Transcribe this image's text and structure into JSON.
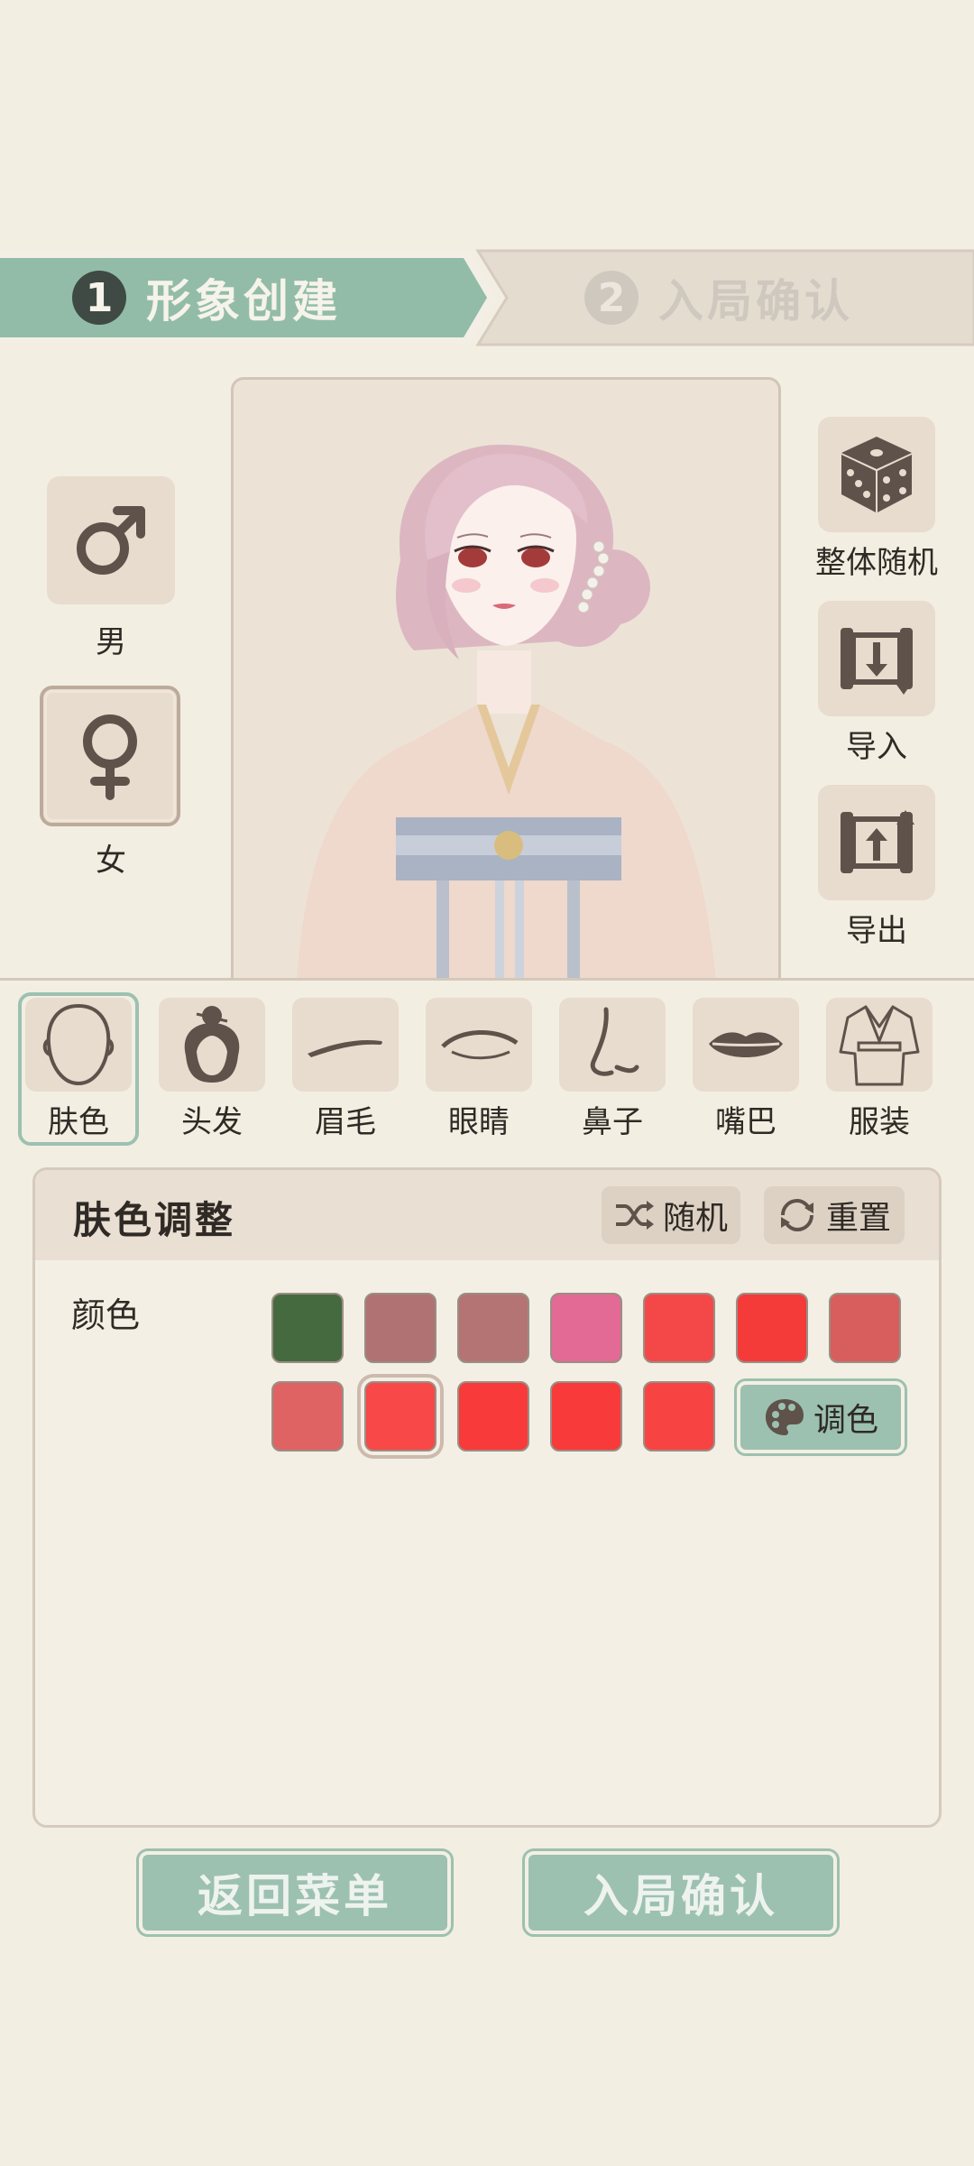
{
  "steps": [
    {
      "num": "1",
      "label": "形象创建"
    },
    {
      "num": "2",
      "label": "入局确认"
    }
  ],
  "gender": {
    "male_label": "男",
    "female_label": "女",
    "selected": "女"
  },
  "side_actions": {
    "random_label": "整体随机",
    "import_label": "导入",
    "export_label": "导出"
  },
  "categories": [
    {
      "label": "肤色",
      "icon": "face-outline-icon"
    },
    {
      "label": "头发",
      "icon": "hair-bun-icon"
    },
    {
      "label": "眉毛",
      "icon": "eyebrow-icon"
    },
    {
      "label": "眼睛",
      "icon": "eye-icon"
    },
    {
      "label": "鼻子",
      "icon": "nose-icon"
    },
    {
      "label": "嘴巴",
      "icon": "lips-icon"
    },
    {
      "label": "服装",
      "icon": "robe-icon"
    }
  ],
  "selected_category": "肤色",
  "panel": {
    "title": "肤色调整",
    "random_label": "随机",
    "reset_label": "重置",
    "color_label": "颜色",
    "palette_label": "调色",
    "swatches_row1": [
      "#456a3f",
      "#b07272",
      "#b57474",
      "#e26a94",
      "#f44848",
      "#f53a3a",
      "#d85d5d"
    ],
    "swatches_row2": [
      "#e06363",
      "#f84848",
      "#f83a3a",
      "#f83a3a",
      "#f84343"
    ],
    "selected_swatch_row": 2,
    "selected_swatch_index": 1
  },
  "buttons": {
    "back_label": "返回菜单",
    "confirm_label": "入局确认"
  },
  "colors": {
    "accent": "#9cc1b0",
    "background": "#f3eee2",
    "tile": "#e7dccd",
    "icon": "#5e524b"
  }
}
